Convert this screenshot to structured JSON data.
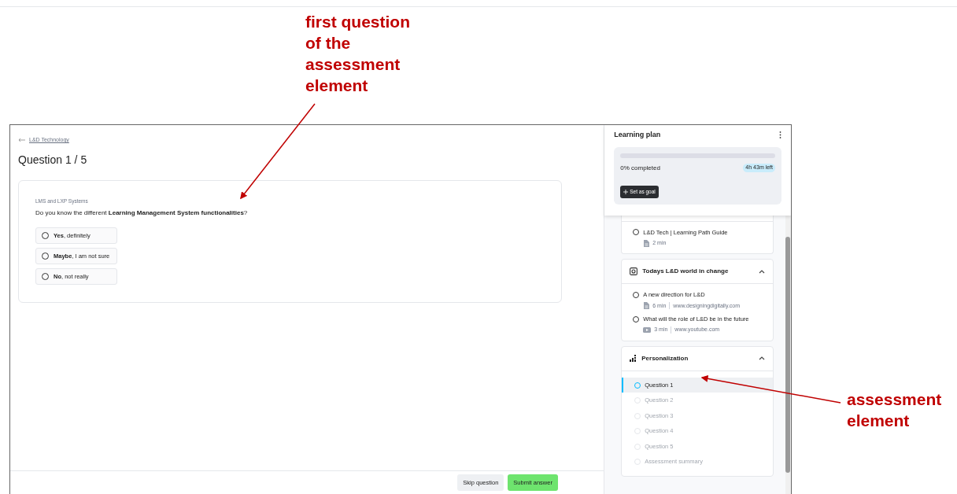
{
  "annotations": [
    {
      "text": "first question of the assessment element"
    },
    {
      "text": "assessment element"
    }
  ],
  "breadcrumb": "L&D Technology",
  "title": "Question 1 / 5",
  "question": {
    "category": "LMS and LXP Systems",
    "prompt": "Do you know the different **Learning Management System functionalities**?",
    "options": [
      {
        "text": "**Yes**, definitely",
        "selected": false
      },
      {
        "text": "**Maybe**, I am not sure",
        "selected": false
      },
      {
        "text": "**No**, not really",
        "selected": false
      }
    ]
  },
  "buttons": [
    {
      "label": "Skip question",
      "kind": "secondary"
    },
    {
      "label": "Submit answer",
      "kind": "primary"
    }
  ],
  "plan": {
    "title": "Learning plan",
    "level": 0,
    "completed": "0% completed",
    "time_left": "4h 43m left",
    "goal_button": "Set as goal"
  },
  "sections": [
    {
      "items": [
        {
          "kind": "document",
          "title": "L&D Tech | Learning Path Guide",
          "duration": "2 min"
        }
      ]
    },
    {
      "title": "Todays L&D world in change",
      "kind": "world",
      "expanded": true,
      "items": [
        {
          "kind": "document",
          "title": "A new direction for L&D",
          "duration": "6 min",
          "source": "www.designingdigitally.com"
        },
        {
          "kind": "video",
          "title": "What will the role of L&D be in the future",
          "duration": "3 min",
          "source": "www.youtube.com"
        }
      ]
    },
    {
      "title": "Personalization",
      "kind": "assessment",
      "expanded": true,
      "items": [
        {
          "kind": "step",
          "title": "Question 1",
          "selected": true,
          "disabled": false
        },
        {
          "kind": "step",
          "title": "Question 2",
          "selected": false,
          "disabled": true
        },
        {
          "kind": "step",
          "title": "Question 3",
          "selected": false,
          "disabled": true
        },
        {
          "kind": "step",
          "title": "Question 4",
          "selected": false,
          "disabled": true
        },
        {
          "kind": "step",
          "title": "Question 5",
          "selected": false,
          "disabled": true
        },
        {
          "kind": "step",
          "title": "Assessment summary",
          "selected": false,
          "disabled": true
        }
      ]
    }
  ]
}
